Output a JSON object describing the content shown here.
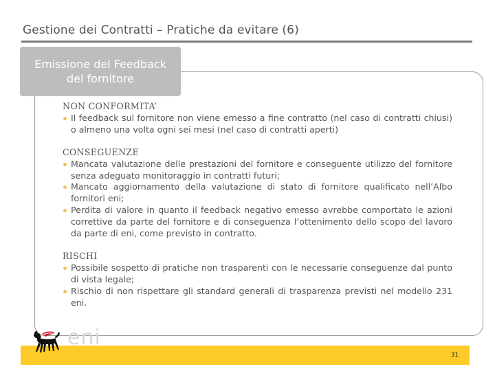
{
  "slide": {
    "title": "Gestione dei Contratti – Pratiche da evitare (6)",
    "page_number": "31"
  },
  "tab": {
    "line1": "Emissione del Feedback",
    "line2": "del fornitore"
  },
  "sections": [
    {
      "heading": "NON CONFORMITA’",
      "bullets": [
        "Il feedback sul fornitore non viene emesso a fine contratto (nel caso di contratti chiusi) o almeno una volta ogni sei mesi (nel caso di contratti aperti)"
      ]
    },
    {
      "heading": "CONSEGUENZE",
      "bullets": [
        "Mancata valutazione delle prestazioni del fornitore e conseguente utilizzo del fornitore senza adeguato monitoraggio in contratti futuri;",
        "Mancato aggiornamento della valutazione di stato di fornitore qualificato nell’Albo fornitori eni;",
        "Perdita di valore in quanto il feedback negativo emesso avrebbe  comportato le azioni correttive da parte del fornitore e di conseguenza l’ottenimento dello scopo del lavoro da parte di eni, come previsto in contratto."
      ]
    },
    {
      "heading": "RISCHI",
      "bullets": [
        "Possibile sospetto di pratiche non trasparenti con le necessarie conseguenze dal punto di vista legale;",
        "Rischio di non rispettare gli standard generali di trasparenza previsti nel modello 231 eni."
      ]
    }
  ],
  "logo": {
    "text": "eni",
    "icon": "six-legged-dog-icon"
  },
  "colors": {
    "band": "#fdca27",
    "tab": "#bdbdbd",
    "bullet": "#f0c060",
    "text": "#555555"
  }
}
